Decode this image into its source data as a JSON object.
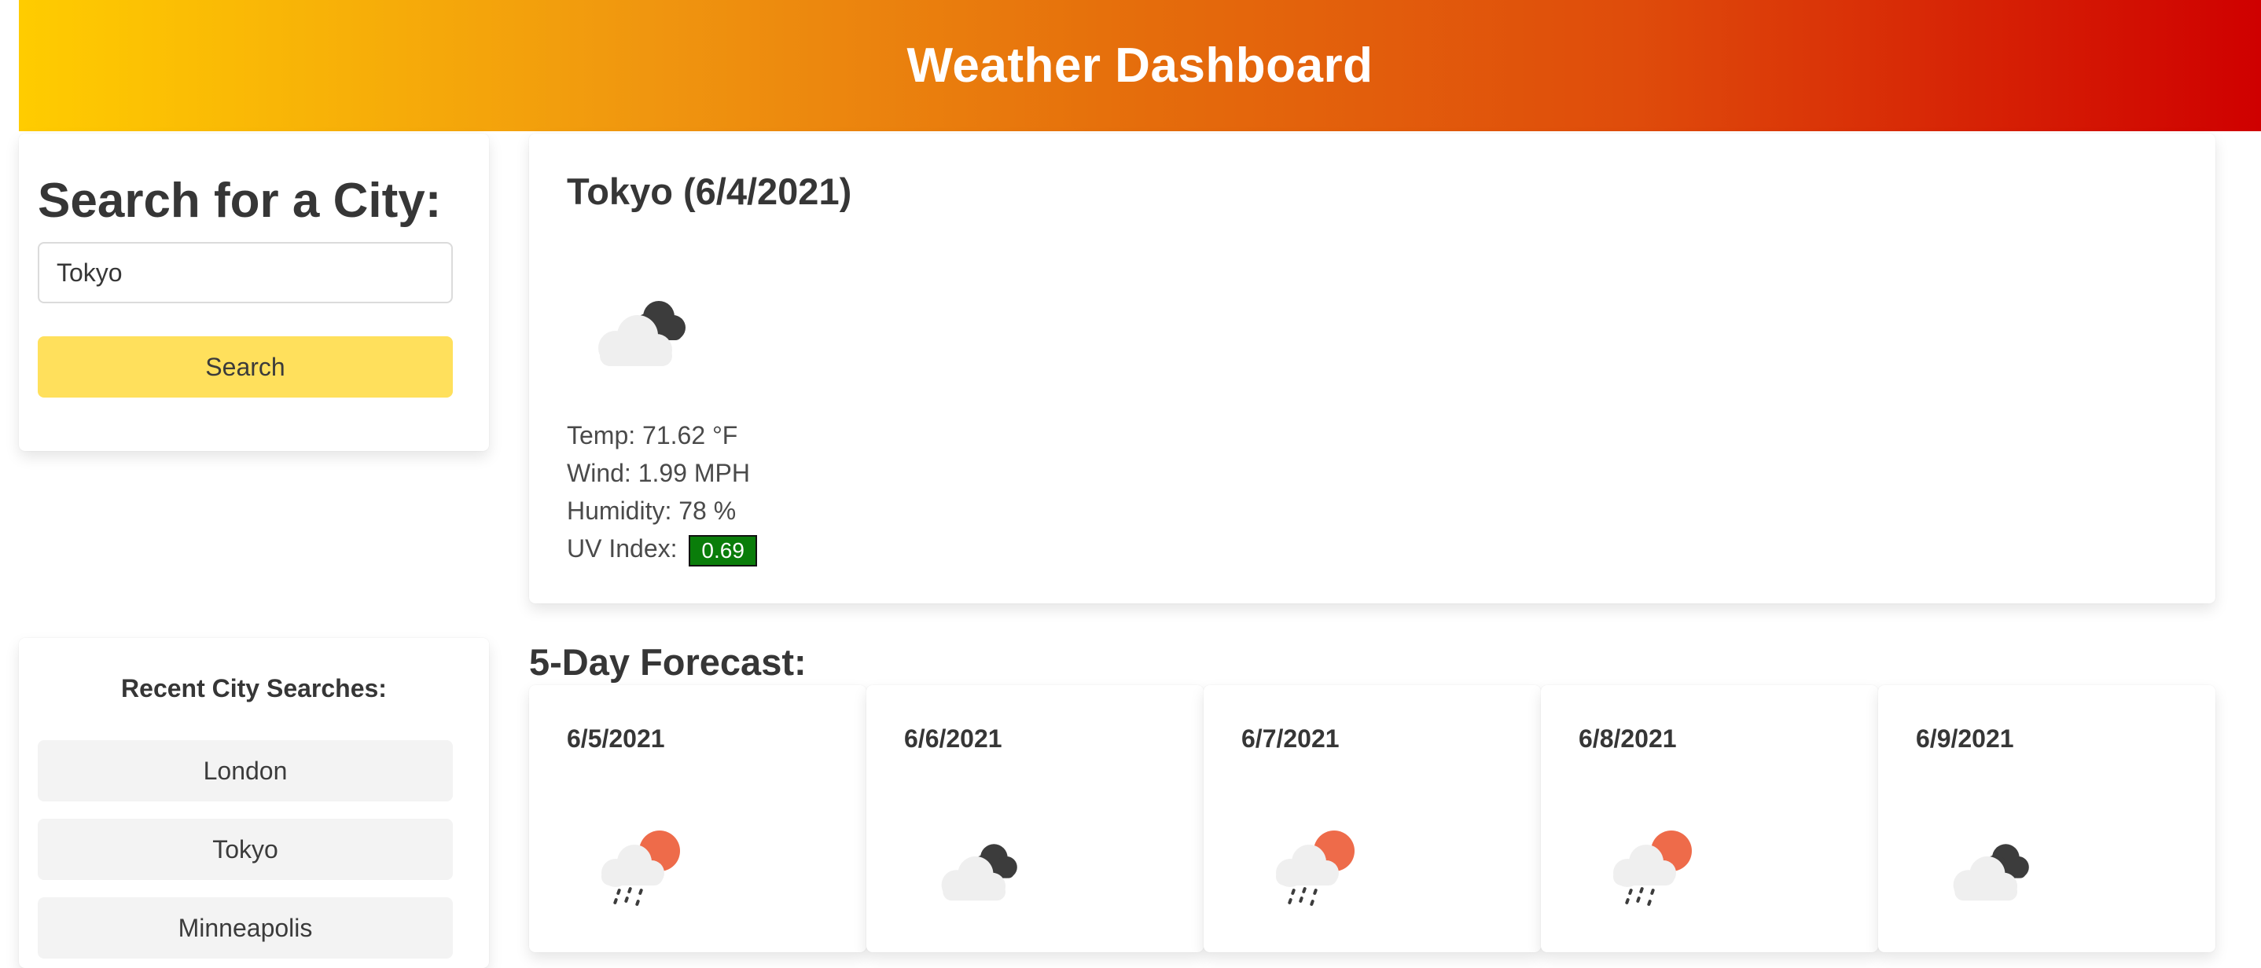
{
  "header": {
    "title": "Weather Dashboard"
  },
  "search": {
    "title": "Search for a City:",
    "input_value": "Tokyo",
    "button_label": "Search"
  },
  "recent": {
    "title": "Recent City Searches:",
    "items": [
      "London",
      "Tokyo",
      "Minneapolis"
    ]
  },
  "current": {
    "title": "Tokyo (6/4/2021)",
    "icon": "cloudy-icon",
    "temp": "Temp: 71.62 °F",
    "wind": "Wind: 1.99 MPH",
    "humidity": "Humidity: 78 %",
    "uv_label": "UV Index:",
    "uv_value": "0.69",
    "uv_color": "#0a7d0a"
  },
  "forecast": {
    "title": "5-Day Forecast:",
    "days": [
      {
        "date": "6/5/2021",
        "icon": "rain-sun-icon"
      },
      {
        "date": "6/6/2021",
        "icon": "cloudy-icon"
      },
      {
        "date": "6/7/2021",
        "icon": "rain-sun-icon"
      },
      {
        "date": "6/8/2021",
        "icon": "rain-sun-icon"
      },
      {
        "date": "6/9/2021",
        "icon": "cloudy-icon"
      }
    ]
  },
  "colors": {
    "header_gradient_start": "#ffcc00",
    "header_gradient_end": "#cf0000",
    "search_button": "#ffe05c",
    "recent_item_bg": "#f3f3f3"
  }
}
